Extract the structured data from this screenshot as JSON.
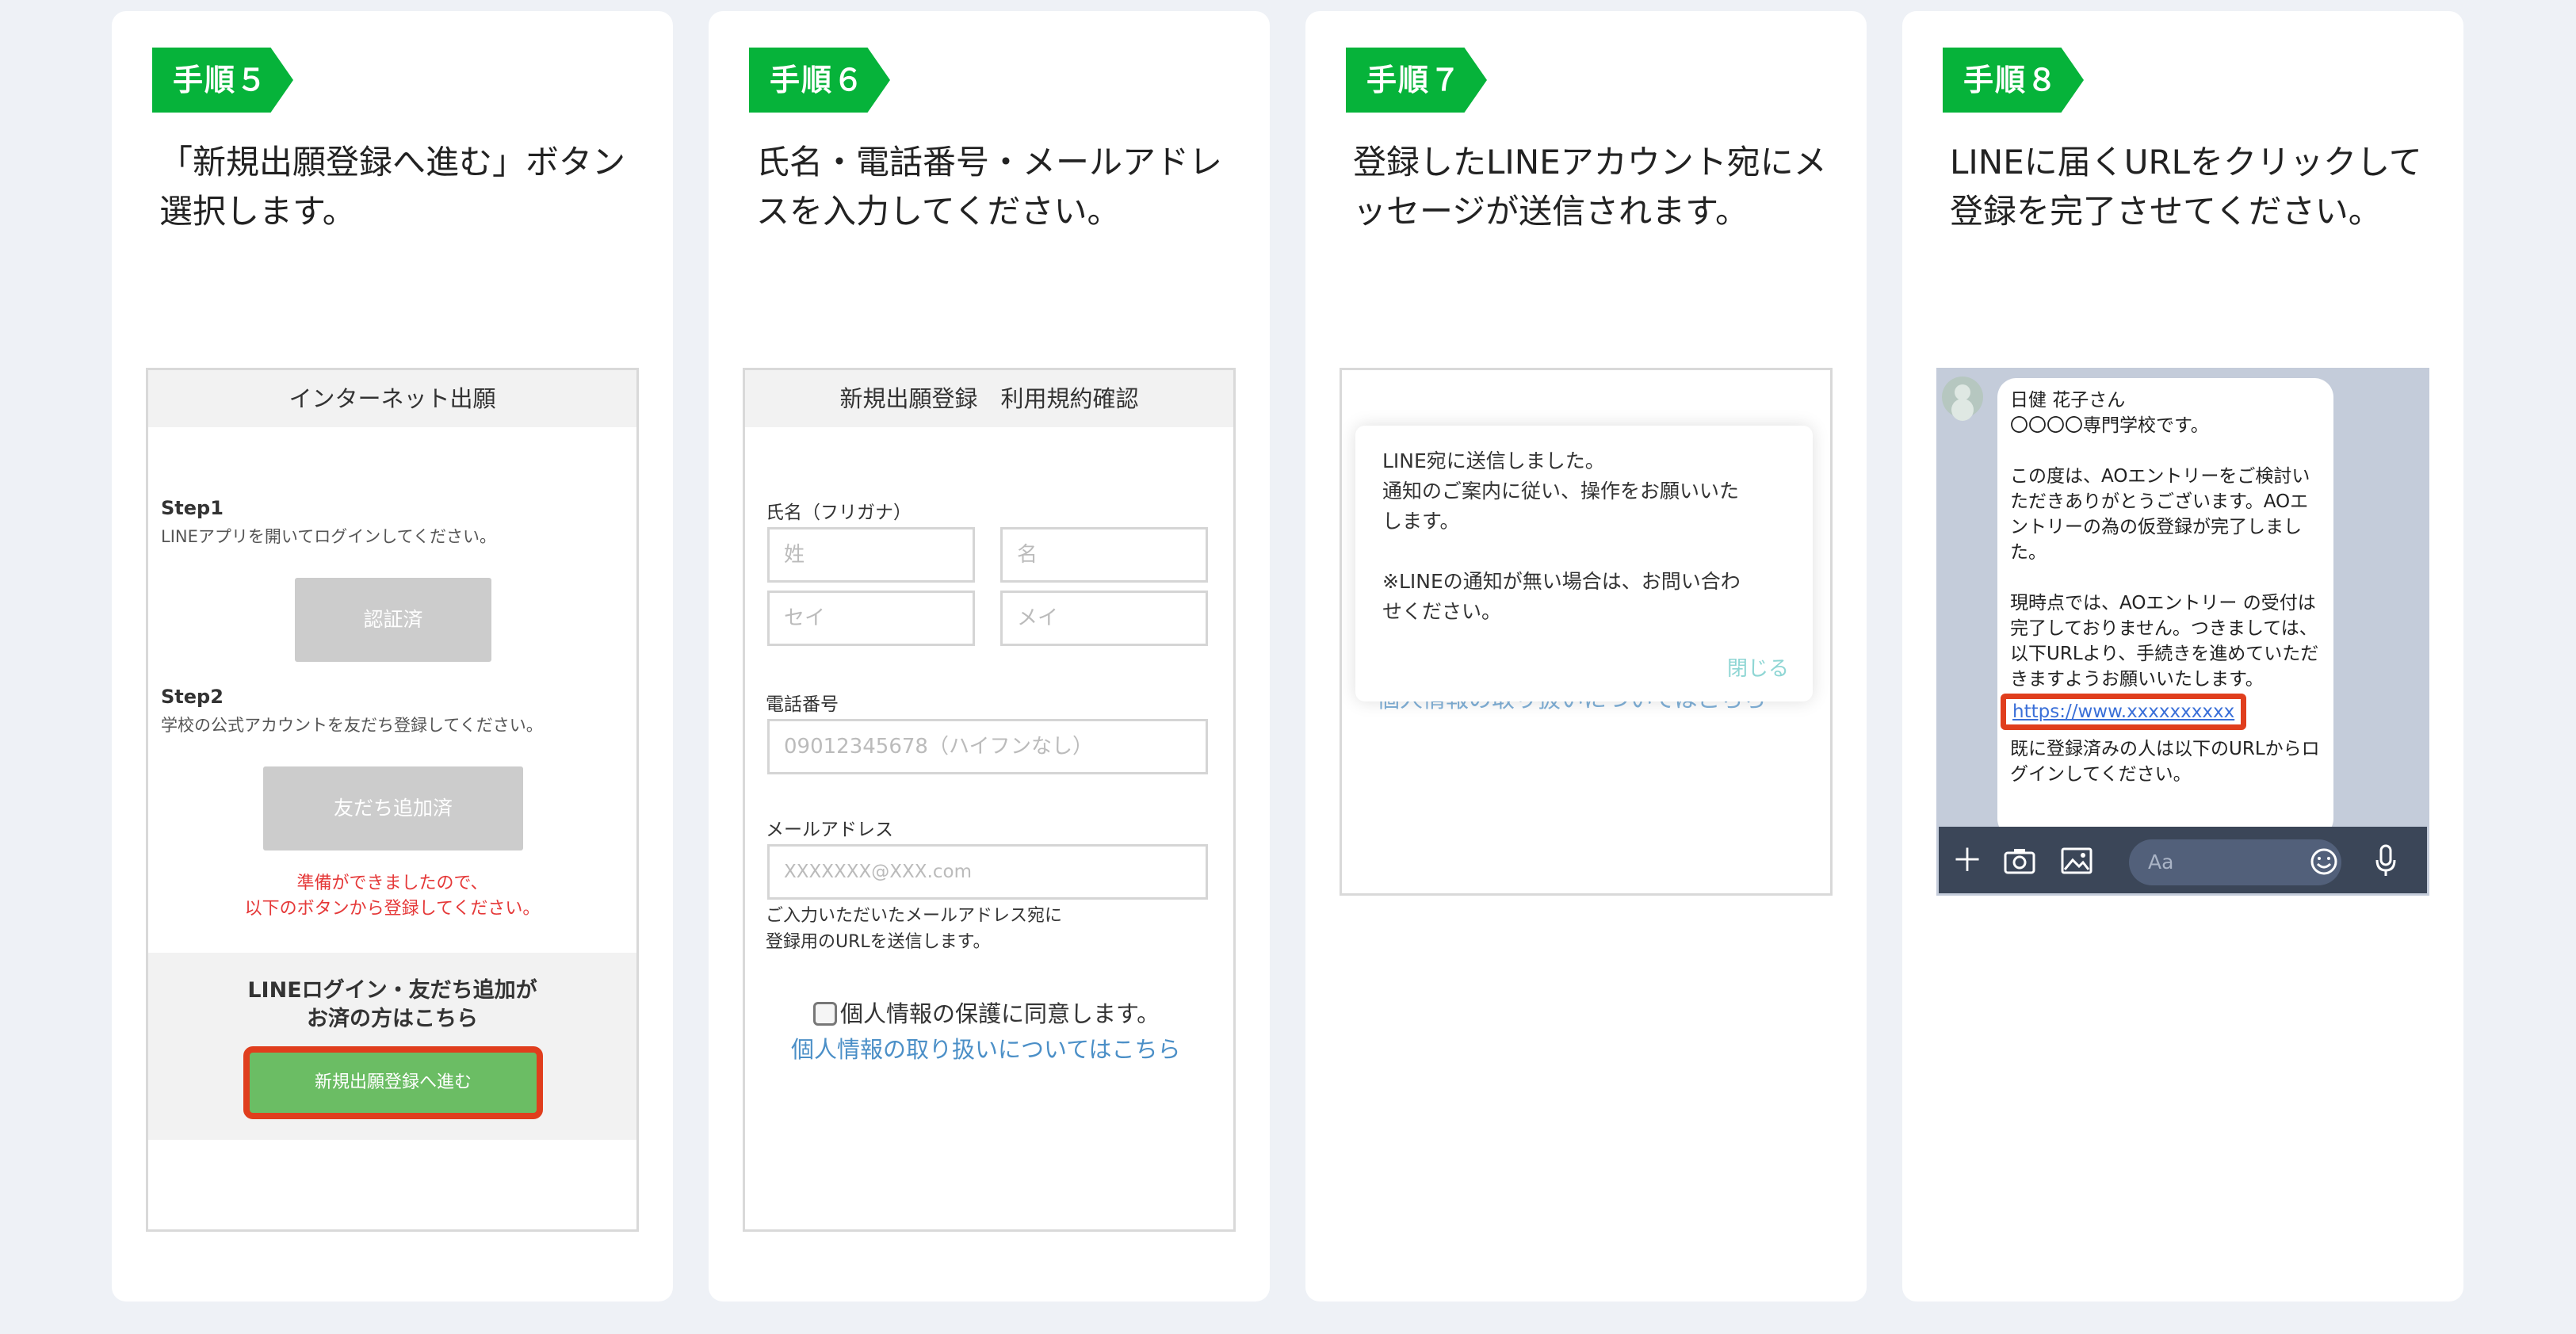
{
  "steps": [
    {
      "badge": "手順５",
      "desc": "「新規出願登録へ進む」ボタン選択します。"
    },
    {
      "badge": "手順６",
      "desc": "氏名・電話番号・メールアドレスを入力してください。"
    },
    {
      "badge": "手順７",
      "desc": "登録したLINEアカウント宛にメッセージが送信されます。"
    },
    {
      "badge": "手順８",
      "desc": "LINEに届くURLをクリックして登録を完了させてください。"
    }
  ],
  "screen5": {
    "header": "インターネット出願",
    "step1_title": "Step1",
    "step1_desc": "LINEアプリを開いてログインしてください。",
    "auth_button": "認証済",
    "step2_title": "Step2",
    "step2_desc": "学校の公式アカウントを友だち登録してください。",
    "friend_button": "友だち追加済",
    "notice_line1": "準備ができましたので、",
    "notice_line2": "以下のボタンから登録してください。",
    "login_text_line1": "LINEログイン・友だち追加が",
    "login_text_line2": "お済の方はこちら",
    "new_button": "新規出願登録へ進む"
  },
  "screen6": {
    "header": "新規出願登録　利用規約確認",
    "name_label": "氏名（フリガナ）",
    "last_name_placeholder": "姓",
    "first_name_placeholder": "名",
    "last_kana_placeholder": "セイ",
    "first_kana_placeholder": "メイ",
    "phone_label": "電話番号",
    "phone_placeholder": "09012345678（ハイフンなし）",
    "email_label": "メールアドレス",
    "email_placeholder": "XXXXXXX@XXX.com",
    "email_note_line1": "ご入力いただいたメールアドレス宛に",
    "email_note_line2": "登録用のURLを送信します。",
    "consent": "個人情報の保護に同意します。",
    "privacy_link": "個人情報の取り扱いについてはこちら"
  },
  "screen7": {
    "line1": "LINE宛に送信しました。",
    "line2": "通知のご案内に従い、操作をお願いいた",
    "line3": "します。",
    "line4": "※LINEの通知が無い場合は、お問い合わ",
    "line5": "せください。",
    "close": "閉じる",
    "behind_link": "個人情報の取り扱いについてはこちら"
  },
  "screen8": {
    "msg1": "日健 花子さん",
    "msg2": "〇〇〇〇専門学校です。",
    "msg3": "この度は、AOエントリーをご検討いただきありがとうございます。AOエントリーの為の仮登録が完了しました。",
    "msg4": "現時点では、AOエントリー の受付は完了しておりません。つきましては、以下URLより、手続きを進めていただきますようお願いいたします。",
    "url": "https://www.xxxxxxxxxx",
    "msg5": "既に登録済みの人は以下のURLからログインしてください。",
    "input_placeholder": "Aa"
  }
}
